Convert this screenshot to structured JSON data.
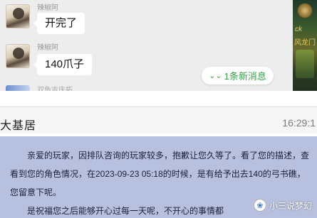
{
  "chat": {
    "messages": [
      {
        "sender": "辣椒阿",
        "text": "开完了"
      },
      {
        "sender": "辣椒阿",
        "text": "140爪子"
      }
    ],
    "partial_sender": "双鱼吉庆拓",
    "new_message_label": "1条新消息",
    "new_message_icon": "double-chevron-down-icon"
  },
  "side_image": {
    "text_1": "ck",
    "text_2": "风龙门"
  },
  "ticket": {
    "title": "大基居",
    "time": "16:29:1",
    "reply_paragraphs": [
      "亲爱的玩家，因排队咨询的玩家较多，抱歉让您久等了。看了您的描述，查看到您的角色情况，在2023-09-23 05:18的时候，是有给予出去140的弓书礁，您留意下呢。",
      "是祝福您之后能够开心过每一天呢，不开心的事情都"
    ]
  },
  "watermark": {
    "text": "小三说梦幻",
    "icon": "wechat-channel-icon"
  }
}
